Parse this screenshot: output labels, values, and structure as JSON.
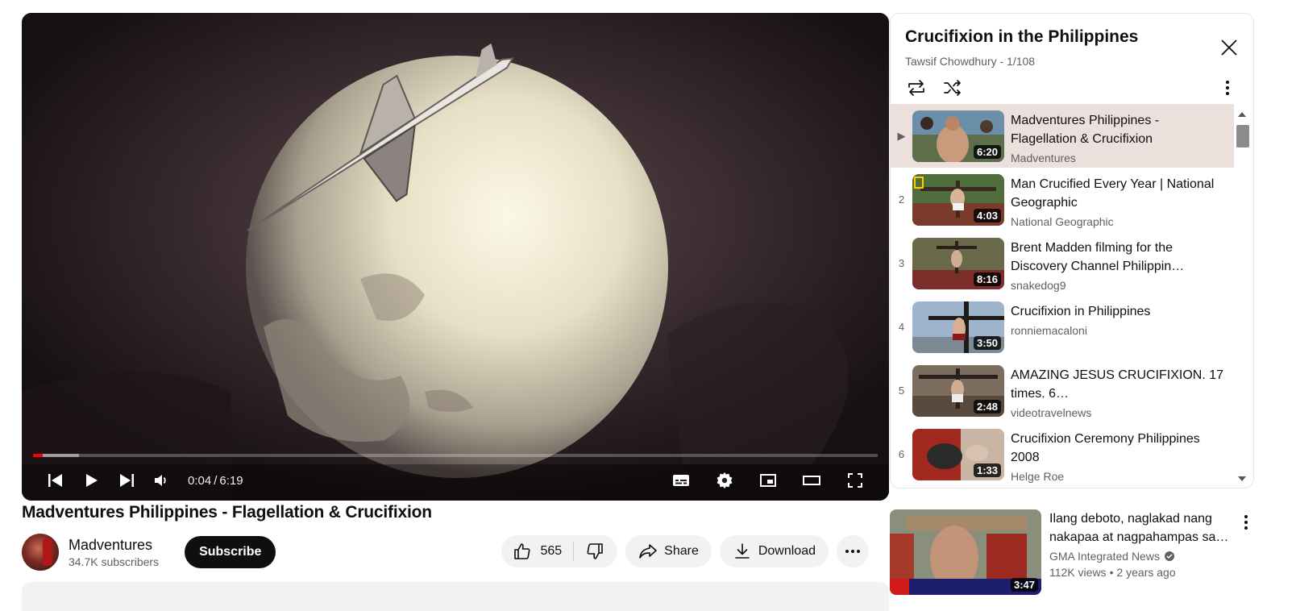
{
  "player": {
    "progress_fraction": 0.011,
    "loaded_fraction": 0.054,
    "time_current": "0:04",
    "time_separator": "/",
    "time_total": "6:19",
    "icons": [
      "previous-icon",
      "play-icon",
      "next-icon",
      "volume-icon",
      "subtitles-icon",
      "settings-icon",
      "miniplayer-icon",
      "theater-icon",
      "fullscreen-icon"
    ]
  },
  "video": {
    "title": "Madventures Philippines - Flagellation & Crucifixion",
    "channel_name": "Madventures",
    "subscribers": "34.7K subscribers",
    "subscribe_label": "Subscribe",
    "like_count": "565",
    "share_label": "Share",
    "download_label": "Download"
  },
  "playlist": {
    "title": "Crucifixion in the Philippines",
    "subtitle": "Tawsif Chowdhury - 1/108",
    "items": [
      {
        "index": "▶",
        "title": "Madventures Philippines - Flagellation & Crucifixion",
        "channel": "Madventures",
        "duration": "6:20",
        "active": true
      },
      {
        "index": "2",
        "title": "Man Crucified Every Year | National Geographic",
        "channel": "National Geographic",
        "duration": "4:03"
      },
      {
        "index": "3",
        "title": "Brent Madden filming for the Discovery Channel Philippin…",
        "channel": "snakedog9",
        "duration": "8:16"
      },
      {
        "index": "4",
        "title": "Crucifixion in Philippines",
        "channel": "ronniemacaloni",
        "duration": "3:50"
      },
      {
        "index": "5",
        "title": "AMAZING JESUS CRUCIFIXION. 17 times. 6…",
        "channel": "videotravelnews",
        "duration": "2:48"
      },
      {
        "index": "6",
        "title": "Crucifixion Ceremony Philippines 2008",
        "channel": "Helge Roe",
        "duration": "1:33"
      }
    ]
  },
  "recommendation": {
    "title": "Ilang deboto, naglakad nang nakapaa at nagpahampas sa…",
    "channel": "GMA Integrated News",
    "views": "112K views",
    "dot": "•",
    "age": "2 years ago",
    "duration": "3:47"
  }
}
